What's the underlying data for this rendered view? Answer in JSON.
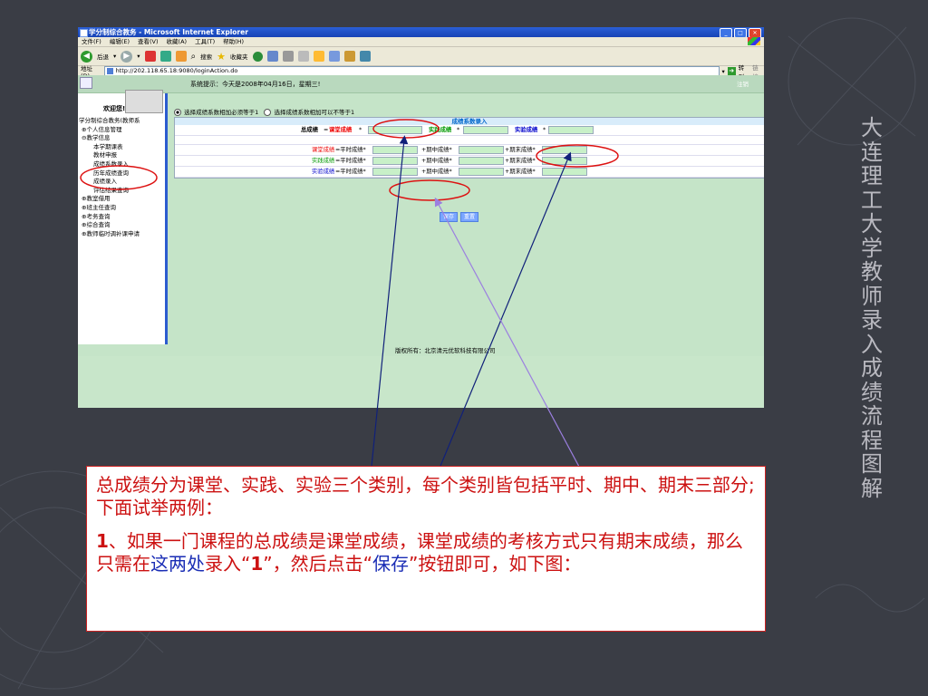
{
  "slide": {
    "vertical_title": "大连理工大学教师录入成绩流程图解"
  },
  "window": {
    "title": "学分制综合教务 - Microsoft Internet Explorer",
    "menu": [
      "文件(F)",
      "编辑(E)",
      "查看(V)",
      "收藏(A)",
      "工具(T)",
      "帮助(H)"
    ],
    "toolbar": {
      "back": "后退",
      "search": "搜索",
      "favorites": "收藏夹"
    },
    "address_label": "地址(D)",
    "address_url": "http://202.118.65.18:9080/loginAction.do",
    "go_label": "转到",
    "links_label": "链接"
  },
  "app": {
    "system_message": "系统提示：今天是2008年04月16日，星期三!",
    "logout": "注销",
    "welcome": "欢迎您!",
    "tree": [
      "学分制综合教务(教师系",
      "⊕个人信息管理",
      "⊖教学信息",
      "本学期课表",
      "教材申报",
      "成绩系数录入",
      "历年成绩查询",
      "成绩录入",
      "评估结果查询",
      "⊕教室借用",
      "⊕班主任查询",
      "⊕考务查询",
      "⊕综合查询",
      "⊕教师临时调补课申请"
    ],
    "radio_options": [
      "选择成绩系数相加必须等于1",
      "选择成绩系数相加可以不等于1"
    ],
    "form_header": "成绩系数录入",
    "total_row": {
      "label": "总成绩",
      "eq": "=",
      "classroom": "课堂成绩",
      "practice": "实践成绩",
      "experiment": "实验成绩",
      "star": "*"
    },
    "rows": [
      {
        "name": "课堂成绩",
        "eq": "=平时成绩*",
        "mid": "+期中成绩*",
        "final": "+期末成绩*"
      },
      {
        "name": "实践成绩",
        "eq": "=平时成绩*",
        "mid": "+期中成绩*",
        "final": "+期末成绩*"
      },
      {
        "name": "实验成绩",
        "eq": "=平时成绩*",
        "mid": "+期中成绩*",
        "final": "+期末成绩*"
      }
    ],
    "save_button": "保存",
    "reset_button": "重置",
    "copyright": "版权所有：北京清元优软科技有限公司"
  },
  "caption": {
    "p1": "总成绩分为课堂、实践、实验三个类别，每个类别皆包括平时、期中、期末三部分;下面试举两例：",
    "p2_num": "1",
    "p2_a": "、如果一门课程的总成绩是课堂成绩，课堂成绩的考核方式只有期末成绩，那么只需在",
    "p2_hl1": "这两处",
    "p2_b": "录入“",
    "p2_one": "1",
    "p2_c": "”，然后点击“",
    "p2_hl2": "保存",
    "p2_d": "”按钮即可，如下图："
  },
  "colors": {
    "slide_bg": "#3a3d45",
    "caption_text": "#cc1111",
    "highlight": "#1a2db5",
    "annotation_red": "#d11",
    "arrow_blue": "#10207a",
    "arrow_purple": "#9b7fe0"
  }
}
